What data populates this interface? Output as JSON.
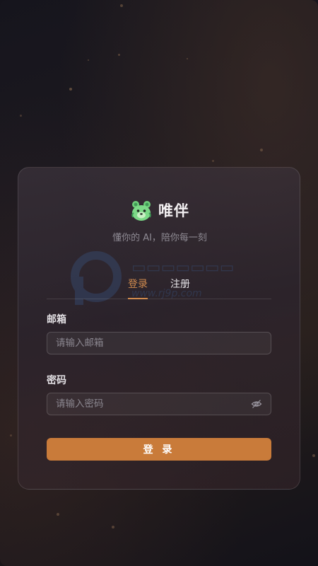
{
  "app": {
    "name": "唯伴",
    "tagline": "懂你的 AI，陪你每一刻"
  },
  "tabs": {
    "login_label": "登录",
    "register_label": "注册"
  },
  "form": {
    "email_label": "邮箱",
    "email_placeholder": "请输入邮箱",
    "password_label": "密码",
    "password_placeholder": "请输入密码",
    "submit_label": "登 录"
  },
  "watermark": {
    "url_text": "www.rj9p.com"
  },
  "colors": {
    "accent": "#cf8a4e",
    "button": "#c97b3a",
    "background": "#16151d"
  },
  "icons": {
    "logo": "bear-logo-icon",
    "password_toggle": "eye-off-icon"
  }
}
